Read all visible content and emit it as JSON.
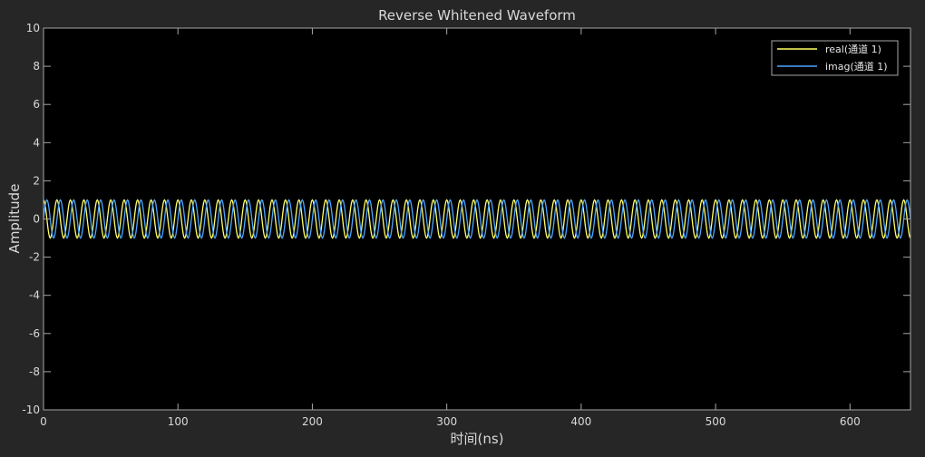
{
  "window": {
    "background": "#262626",
    "axes_background": "#000000",
    "axis_color": "#a6a6a6",
    "grid_color": "#404040"
  },
  "chart_data": {
    "type": "line",
    "title": "Reverse Whitened Waveform",
    "xlabel": "时间(ns)",
    "ylabel": "Amplitude",
    "xlim": [
      0,
      645
    ],
    "ylim": [
      -10,
      10
    ],
    "xticks": [
      0,
      100,
      200,
      300,
      400,
      500,
      600
    ],
    "yticks": [
      -10,
      -8,
      -6,
      -4,
      -2,
      0,
      2,
      4,
      6,
      8,
      10
    ],
    "grid": false,
    "legend_position": "top-right",
    "waveform": {
      "period_ns": 10,
      "amplitude": 1,
      "sample_step_ns": 0.5
    },
    "series": [
      {
        "name": "real(通道 1)",
        "color": "#ffff66",
        "function": "cos",
        "phase_deg": 0
      },
      {
        "name": "imag(通道 1)",
        "color": "#4da6ff",
        "function": "cos",
        "phase_deg": -90
      }
    ]
  }
}
